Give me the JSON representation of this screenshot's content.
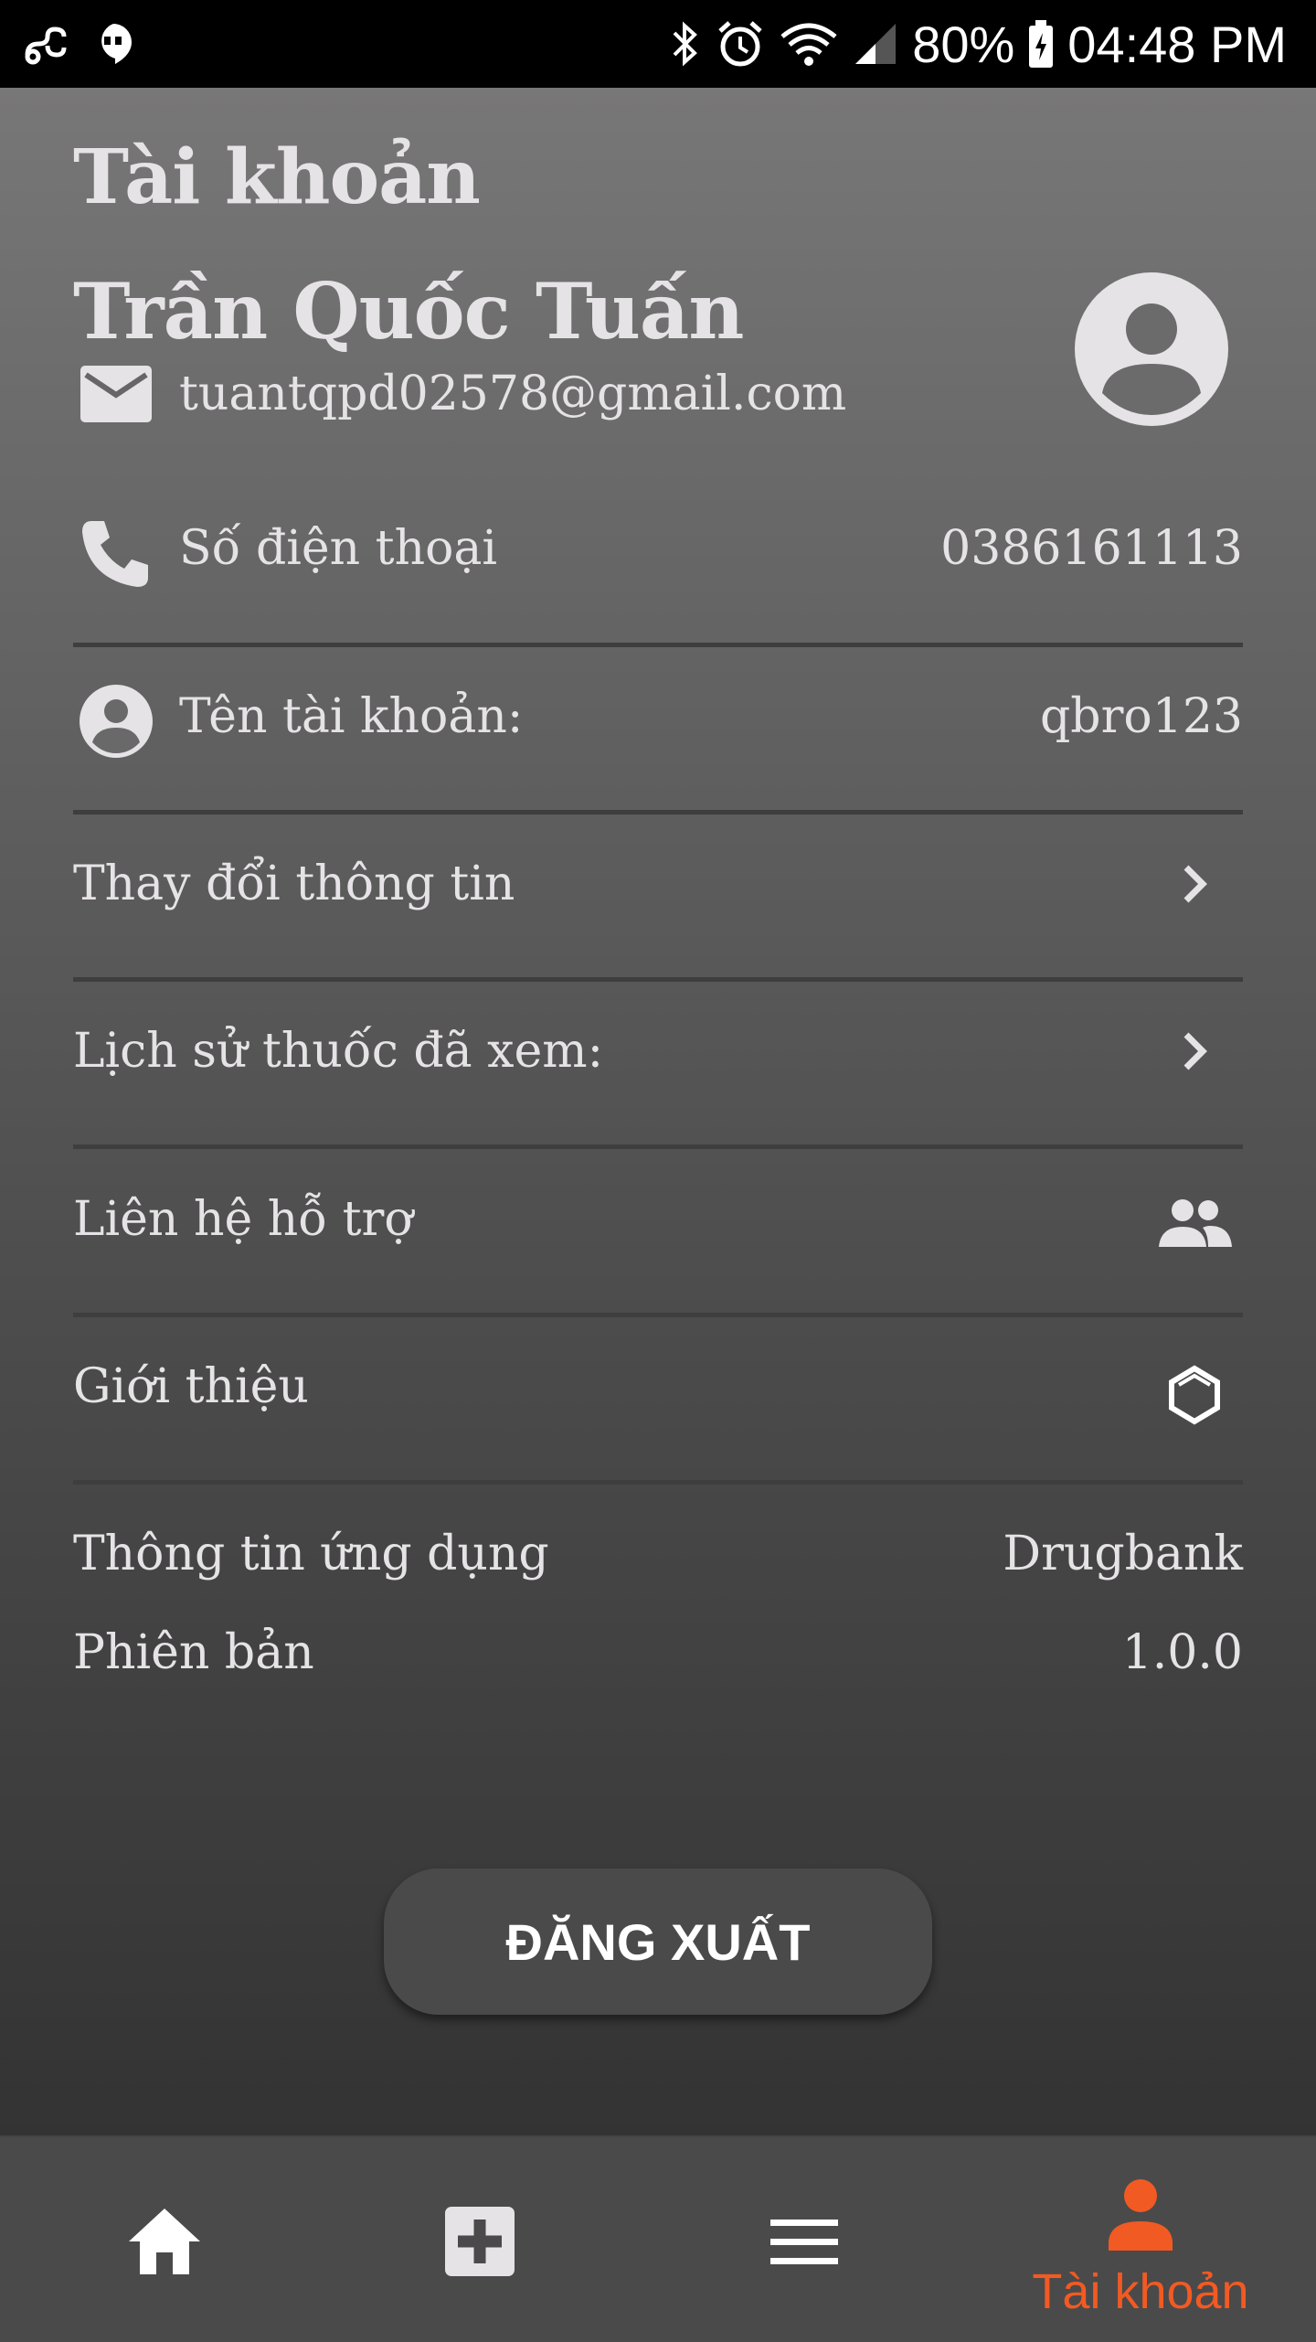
{
  "colors": {
    "accent": "#f25a23",
    "text": "#e6e3e6",
    "divider": "#3e3e3e",
    "nav_bg": "#4a4a4a"
  },
  "status_bar": {
    "battery": "80%",
    "time": "04:48 PM",
    "icons": [
      "link-icon",
      "hangouts-icon",
      "bluetooth-icon",
      "alarm-icon",
      "wifi-icon",
      "signal-icon",
      "battery-icon"
    ]
  },
  "header": {
    "title": "Tài khoản"
  },
  "profile": {
    "name": "Trần Quốc Tuấn",
    "email": "tuantqpd02578@gmail.com"
  },
  "rows": {
    "phone": {
      "label": "Số điện thoại",
      "value": "0386161113"
    },
    "username": {
      "label": "Tên tài khoản:",
      "value": "qbro123"
    },
    "edit_info": {
      "label": "Thay đổi thông tin"
    },
    "history": {
      "label": "Lịch sử thuốc đã xem:"
    },
    "support": {
      "label": "Liên hệ hỗ trợ"
    },
    "about": {
      "label": "Giới thiệu"
    },
    "app_info": {
      "label": "Thông tin ứng dụng",
      "value": "Drugbank"
    },
    "version": {
      "label": "Phiên bản",
      "value": "1.0.0"
    }
  },
  "logout_button": {
    "label": "ĐĂNG XUẤT"
  },
  "bottom_nav": {
    "items": [
      {
        "icon": "home-icon"
      },
      {
        "icon": "medical-plus-icon"
      },
      {
        "icon": "menu-icon"
      },
      {
        "icon": "person-icon",
        "label": "Tài khoản",
        "active": true
      }
    ]
  }
}
